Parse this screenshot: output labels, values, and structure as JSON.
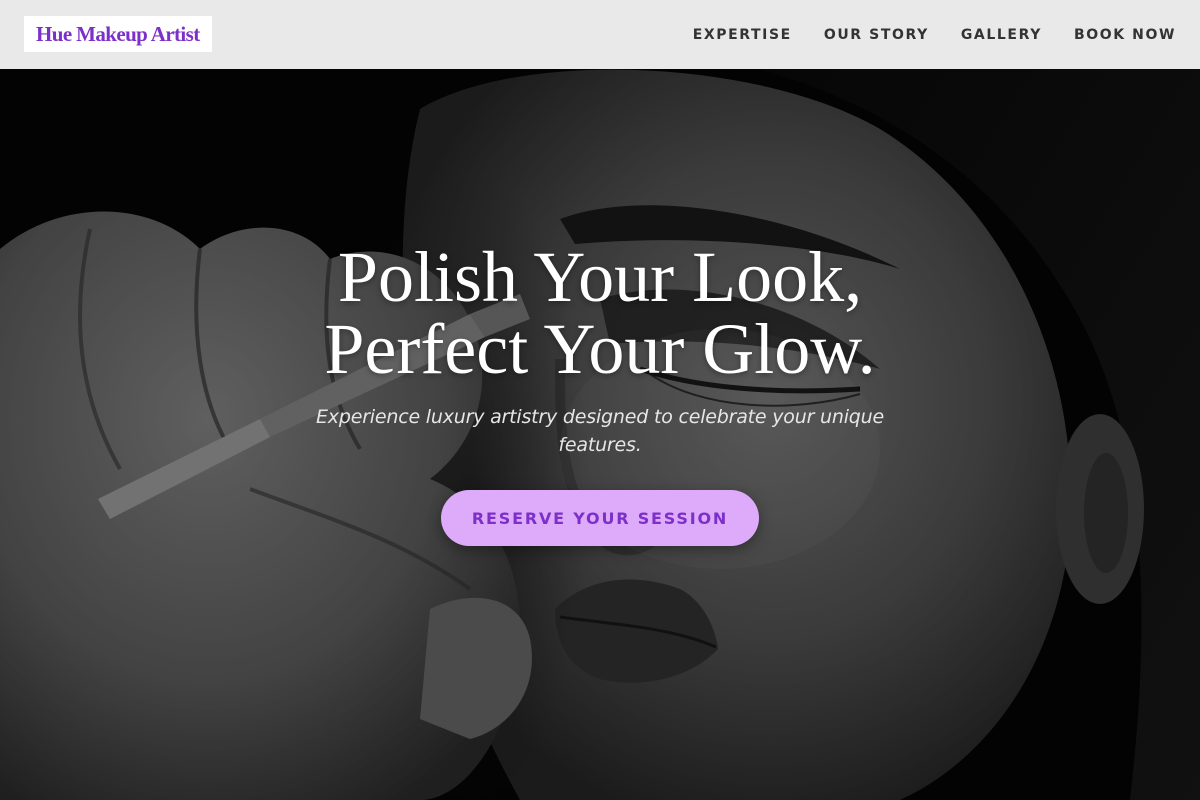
{
  "brand": {
    "name": "Hue Makeup Artist",
    "color": "#7c2fc9"
  },
  "nav": {
    "items": [
      {
        "label": "EXPERTISE"
      },
      {
        "label": "OUR STORY"
      },
      {
        "label": "GALLERY"
      },
      {
        "label": "BOOK NOW"
      }
    ]
  },
  "hero": {
    "title_line1": "Polish Your Look,",
    "title_line2": "Perfect Your Glow.",
    "subtitle": "Experience luxury artistry designed to celebrate your unique features.",
    "cta_label": "RESERVE YOUR SESSION",
    "cta_bg": "#ddabfa",
    "image": "black-and-white photo of makeup artist's hands applying makeup to a woman's face"
  }
}
